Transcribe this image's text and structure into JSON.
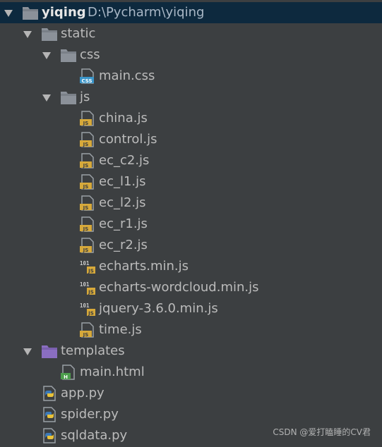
{
  "project": {
    "name": "yiqing",
    "path": "D:\\Pycharm\\yiqing"
  },
  "tree": {
    "static": "static",
    "css": "css",
    "main_css": "main.css",
    "js": "js",
    "china_js": "china.js",
    "control_js": "control.js",
    "ec_c2_js": "ec_c2.js",
    "ec_l1_js": "ec_l1.js",
    "ec_l2_js": "ec_l2.js",
    "ec_r1_js": "ec_r1.js",
    "ec_r2_js": "ec_r2.js",
    "echarts_min_js": "echarts.min.js",
    "echarts_wordcloud_min_js": "echarts-wordcloud.min.js",
    "jquery_js": "jquery-3.6.0.min.js",
    "time_js": "time.js",
    "templates": "templates",
    "main_html": "main.html",
    "app_py": "app.py",
    "spider_py": "spider.py",
    "sqldata_py": "sqldata.py"
  },
  "icons": {
    "css_badge": "CSS",
    "js_badge": "JS",
    "min_js_digits": "101",
    "html_badge": "H"
  },
  "watermark": "CSDN @爱打瞌睡的CV君",
  "colors": {
    "background": "#3c3f41",
    "selected_row": "#0d293e",
    "folder": "#8b9199",
    "template_folder": "#8a6ec1",
    "js_badge": "#d7a93a",
    "css_badge": "#3a95c9",
    "html_badge": "#4c9e4c"
  }
}
